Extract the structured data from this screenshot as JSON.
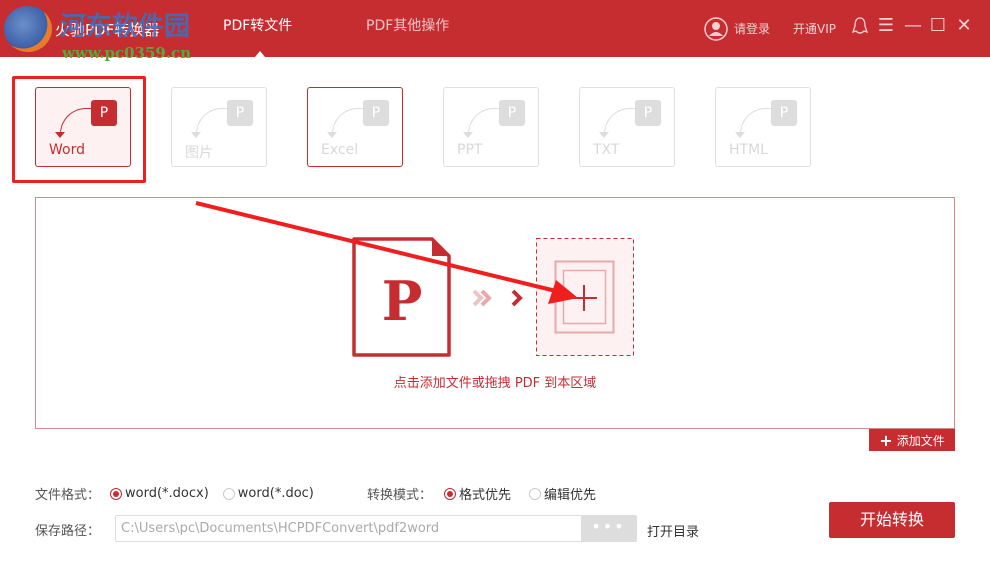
{
  "header": {
    "app_title": "火驰PDF转换器",
    "watermark_text": "河东软件园",
    "watermark_url": "www.pc0359.cn",
    "tabs": [
      {
        "label": "PDF转文件",
        "active": true
      },
      {
        "label": "PDF其他操作",
        "active": false
      }
    ],
    "login": "请登录",
    "vip": "开通VIP"
  },
  "formats": [
    {
      "label": "Word"
    },
    {
      "label": "图片"
    },
    {
      "label": "Excel"
    },
    {
      "label": "PPT"
    },
    {
      "label": "TXT"
    },
    {
      "label": "HTML"
    }
  ],
  "format_icon_letter": "P",
  "drop": {
    "hint": "点击添加文件或拖拽 PDF 到本区域",
    "pdf_letter": "P",
    "add_file": "添加文件"
  },
  "options": {
    "format_label": "文件格式：",
    "format_opts": [
      "word(*.docx)",
      "word(*.doc)"
    ],
    "mode_label": "转换模式：",
    "mode_opts": [
      "格式优先",
      "编辑优先"
    ],
    "path_label": "保存路径：",
    "path_value": "C:\\Users\\pc\\Documents\\HCPDFConvert\\pdf2word",
    "browse": "•••",
    "open_dir": "打开目录",
    "start": "开始转换"
  },
  "colors": {
    "accent": "#c52d31",
    "annotation": "#f01e1e"
  }
}
